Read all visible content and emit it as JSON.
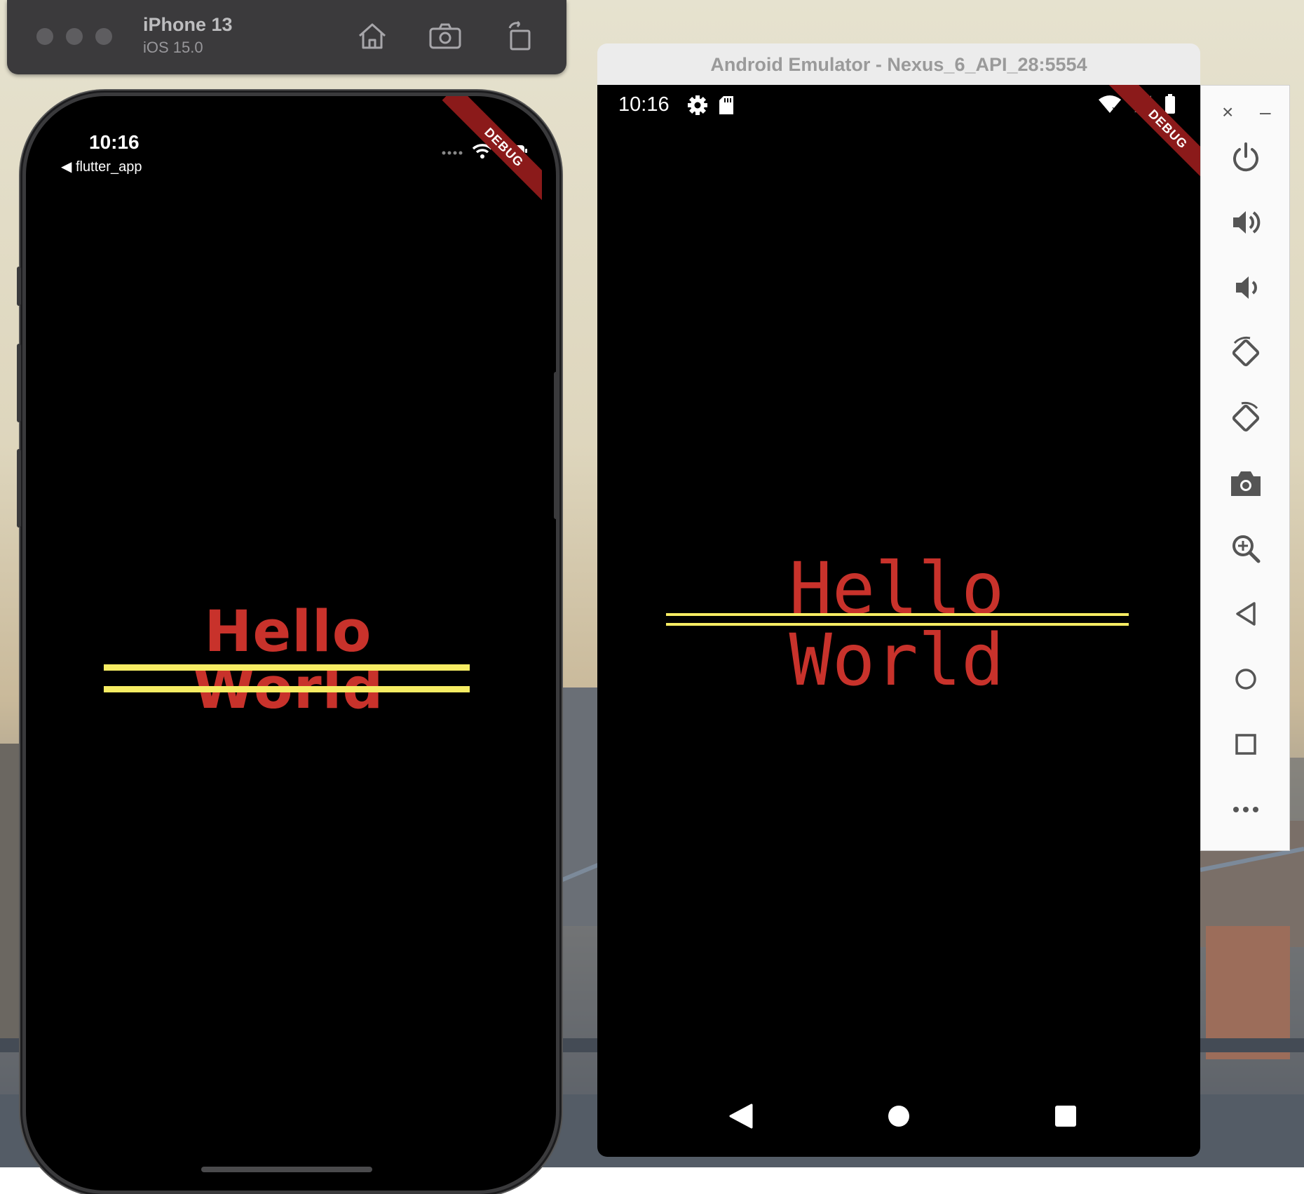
{
  "desktop": {
    "wallpaper": "city-bridge"
  },
  "ios_simulator": {
    "toolbar": {
      "title": "iPhone 13",
      "subtitle": "iOS 15.0",
      "icons": [
        "home-icon",
        "screenshot-icon",
        "rotate-icon"
      ]
    },
    "status": {
      "time": "10:16",
      "back_label": "◀ flutter_app"
    },
    "debug_banner": "DEBUG",
    "content": {
      "text": "Hello World",
      "color": "#c8322b",
      "decoration_color": "#f6ec63",
      "decoration": "double-underline"
    }
  },
  "android_emulator": {
    "title": "Android Emulator - Nexus_6_API_28:5554",
    "status": {
      "time": "10:16"
    },
    "debug_banner": "DEBUG",
    "content": {
      "text": "Hello World",
      "color": "#c8322b",
      "decoration_color": "#f6ec63",
      "decoration": "double-underline"
    },
    "nav_buttons": [
      "back-icon",
      "home-icon",
      "recents-icon"
    ],
    "side_panel": {
      "window_controls": {
        "close": "×",
        "minimize": "–"
      },
      "tools": [
        "power-icon",
        "volume-up-icon",
        "volume-down-icon",
        "rotate-left-icon",
        "rotate-right-icon",
        "camera-icon",
        "zoom-icon",
        "back-icon",
        "home-icon",
        "overview-icon",
        "more-icon"
      ]
    }
  }
}
